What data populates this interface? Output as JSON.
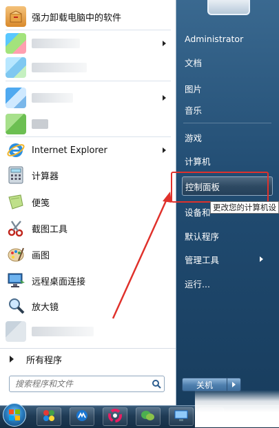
{
  "left_pane": {
    "programs": [
      {
        "label": "强力卸载电脑中的软件",
        "icon": "uninstaller-box-icon",
        "redacted": false,
        "submenu": false
      },
      {
        "label": "",
        "icon": "pixelated-app-icon",
        "redacted": true,
        "submenu": true
      },
      {
        "label": "",
        "icon": "pixelated-app-icon",
        "redacted": true,
        "submenu": false
      },
      {
        "label": "",
        "icon": "pixelated-app-icon",
        "redacted": true,
        "submenu": true
      },
      {
        "label": "",
        "icon": "pixelated-app-icon",
        "redacted": true,
        "submenu": false
      },
      {
        "label": "Internet Explorer",
        "icon": "internet-explorer-icon",
        "redacted": false,
        "submenu": true
      },
      {
        "label": "计算器",
        "icon": "calculator-icon",
        "redacted": false,
        "submenu": false
      },
      {
        "label": "便笺",
        "icon": "sticky-notes-icon",
        "redacted": false,
        "submenu": false
      },
      {
        "label": "截图工具",
        "icon": "scissors-icon",
        "redacted": false,
        "submenu": false
      },
      {
        "label": "画图",
        "icon": "paint-palette-icon",
        "redacted": false,
        "submenu": false
      },
      {
        "label": "远程桌面连接",
        "icon": "remote-desktop-icon",
        "redacted": false,
        "submenu": false
      },
      {
        "label": "放大镜",
        "icon": "magnifier-icon",
        "redacted": false,
        "submenu": false
      },
      {
        "label": "",
        "icon": "pixelated-app-icon",
        "redacted": true,
        "submenu": false
      }
    ],
    "all_programs": "所有程序",
    "search": {
      "placeholder": "搜索程序和文件"
    }
  },
  "right_pane": {
    "items": [
      {
        "label": "Administrator",
        "submenu": false,
        "highlighted": false
      },
      {
        "label": "文档",
        "submenu": false,
        "highlighted": false
      },
      {
        "label": "图片",
        "submenu": false,
        "highlighted": false
      },
      {
        "label": "音乐",
        "submenu": false,
        "highlighted": false
      },
      {
        "label": "游戏",
        "submenu": false,
        "highlighted": false
      },
      {
        "label": "计算机",
        "submenu": false,
        "highlighted": false
      },
      {
        "label": "控制面板",
        "submenu": false,
        "highlighted": true
      },
      {
        "label": "设备和",
        "submenu": false,
        "highlighted": false
      },
      {
        "label": "默认程序",
        "submenu": false,
        "highlighted": false
      },
      {
        "label": "管理工具",
        "submenu": true,
        "highlighted": false
      },
      {
        "label": "运行...",
        "submenu": false,
        "highlighted": false
      }
    ],
    "tooltip": "更改您的计算机设",
    "shutdown_label": "关机"
  },
  "taskbar": {
    "buttons": [
      {
        "icon": "start-orb-icon"
      },
      {
        "icon": "app-launcher-icon"
      },
      {
        "icon": "mail-app-icon"
      },
      {
        "icon": "color-wheel-icon"
      },
      {
        "icon": "wechat-icon"
      },
      {
        "icon": "monitor-icon"
      },
      {
        "icon": "file-manager-icon"
      }
    ]
  },
  "colors": {
    "annotation_red": "#e0312b",
    "menu_blue": "#214c72",
    "highlight": "#2e4a63"
  }
}
